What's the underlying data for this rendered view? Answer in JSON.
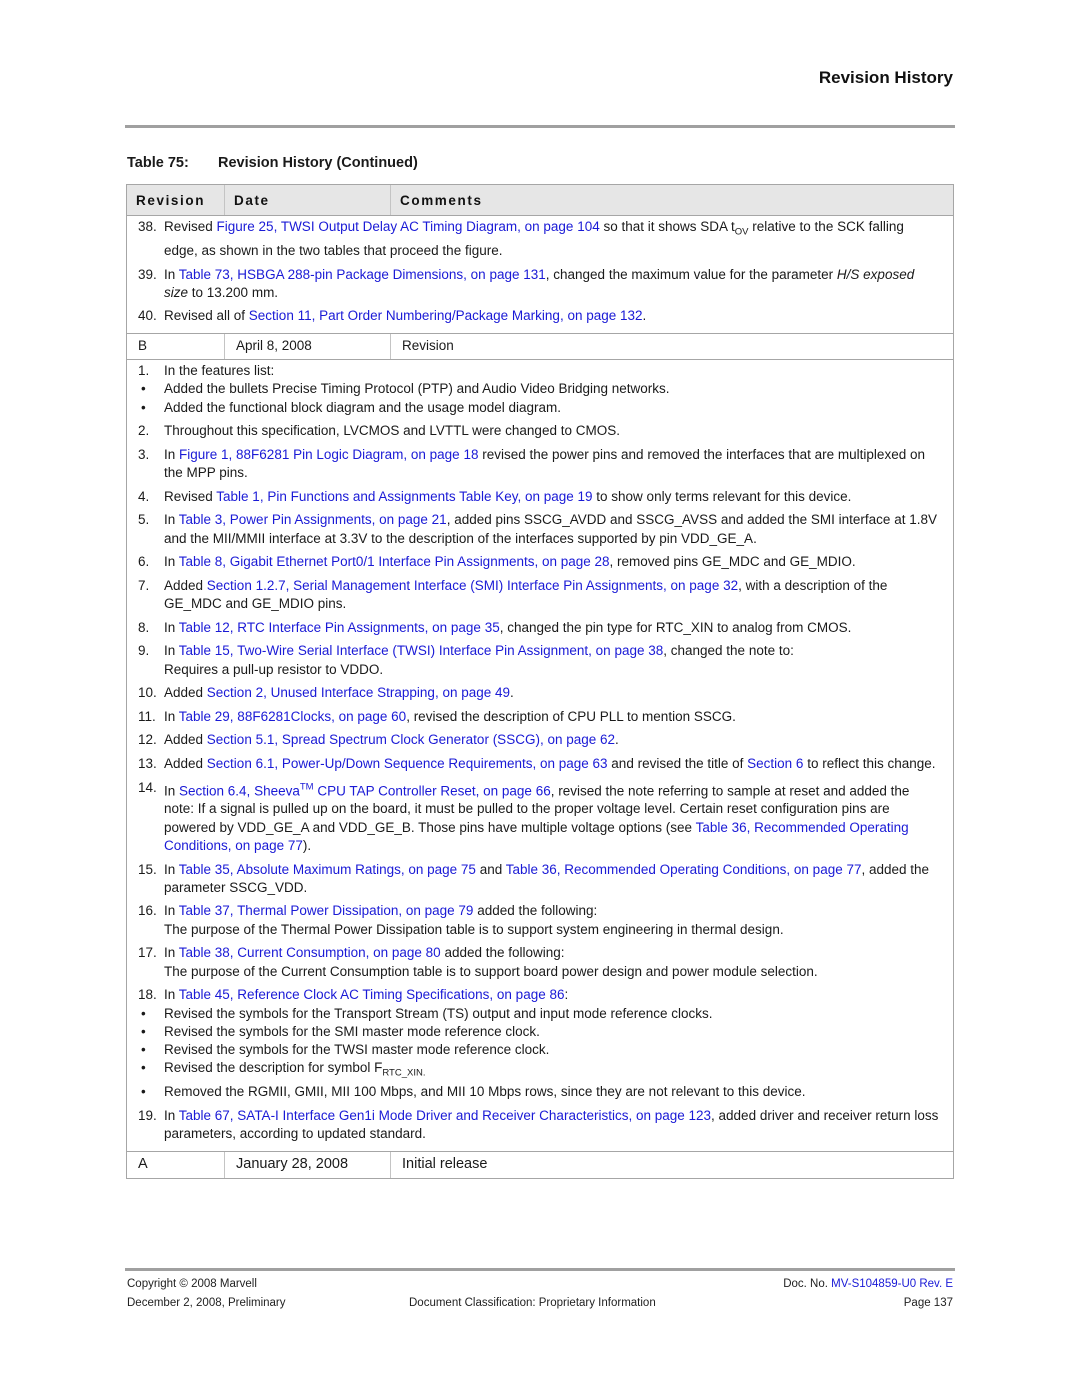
{
  "header": {
    "section_title": "Revision History"
  },
  "table": {
    "caption_number": "Table 75:",
    "caption_title": "Revision History (Continued)",
    "columns": [
      "Revision",
      "Date",
      "Comments"
    ],
    "continued_items": [
      {
        "num": "38.",
        "parts": [
          {
            "t": "Revised "
          },
          {
            "t": "Figure 25, TWSI Output Delay AC Timing Diagram, on page 104",
            "link": true
          },
          {
            "t": " so that it shows SDA t"
          },
          {
            "t": "OV",
            "sub": true
          },
          {
            "t": " relative to the SCK falling edge, as shown in the two tables that proceed the figure."
          }
        ]
      },
      {
        "num": "39.",
        "parts": [
          {
            "t": "In "
          },
          {
            "t": "Table 73, HSBGA 288-pin Package Dimensions, on page 131",
            "link": true
          },
          {
            "t": ", changed the maximum value for the parameter "
          },
          {
            "t": "H/S exposed size",
            "italic": true
          },
          {
            "t": " to 13.200 mm."
          }
        ]
      },
      {
        "num": "40.",
        "parts": [
          {
            "t": "Revised all of "
          },
          {
            "t": "Section 11, Part Order Numbering/Package Marking, on page 132",
            "link": true
          },
          {
            "t": "."
          }
        ]
      }
    ],
    "rev_b": {
      "revision": "B",
      "date": "April 8, 2008",
      "comment": "Revision"
    },
    "rev_b_items": [
      {
        "num": "1.",
        "tight": true,
        "parts": [
          {
            "t": "In the features list:"
          }
        ],
        "bullets": [
          [
            {
              "t": "Added the bullets Precise Timing Protocol (PTP) and Audio Video Bridging networks."
            }
          ],
          [
            {
              "t": "Added the functional block diagram and the usage model diagram."
            }
          ]
        ]
      },
      {
        "num": "2.",
        "parts": [
          {
            "t": "Throughout this specification, LVCMOS and LVTTL were changed to CMOS."
          }
        ]
      },
      {
        "num": "3.",
        "parts": [
          {
            "t": "In "
          },
          {
            "t": "Figure 1, 88F6281 Pin Logic Diagram, on page 18",
            "link": true
          },
          {
            "t": " revised the power pins and removed the interfaces that are multiplexed on the MPP pins."
          }
        ]
      },
      {
        "num": "4.",
        "parts": [
          {
            "t": "Revised "
          },
          {
            "t": "Table 1, Pin Functions and Assignments Table Key, on page 19",
            "link": true
          },
          {
            "t": " to show only terms relevant for this device."
          }
        ]
      },
      {
        "num": "5.",
        "parts": [
          {
            "t": "In "
          },
          {
            "t": "Table 3, Power Pin Assignments, on page 21",
            "link": true
          },
          {
            "t": ", added pins SSCG_AVDD and SSCG_AVSS and added the SMI interface at 1.8V and the MII/MMII interface at 3.3V to the description of the interfaces supported by pin VDD_GE_A."
          }
        ]
      },
      {
        "num": "6.",
        "parts": [
          {
            "t": "In "
          },
          {
            "t": "Table 8, Gigabit Ethernet Port0/1 Interface Pin Assignments, on page 28",
            "link": true
          },
          {
            "t": ", removed pins GE_MDC and GE_MDIO."
          }
        ]
      },
      {
        "num": "7.",
        "parts": [
          {
            "t": "Added "
          },
          {
            "t": "Section 1.2.7, Serial Management Interface (SMI) Interface Pin Assignments, on page 32",
            "link": true
          },
          {
            "t": ", with a description of the GE_MDC and GE_MDIO pins."
          }
        ]
      },
      {
        "num": "8.",
        "parts": [
          {
            "t": "In "
          },
          {
            "t": "Table 12, RTC Interface Pin Assignments, on page 35",
            "link": true
          },
          {
            "t": ", changed the pin type for RTC_XIN to analog from CMOS."
          }
        ]
      },
      {
        "num": "9.",
        "parts": [
          {
            "t": "In "
          },
          {
            "t": "Table 15, Two-Wire Serial Interface (TWSI) Interface Pin Assignment, on page 38",
            "link": true
          },
          {
            "t": ", changed the note to:"
          },
          {
            "br": true
          },
          {
            "t": "Requires a pull-up resistor to VDDO."
          }
        ]
      },
      {
        "num": "10.",
        "parts": [
          {
            "t": "Added "
          },
          {
            "t": "Section 2, Unused Interface Strapping, on page 49",
            "link": true
          },
          {
            "t": "."
          }
        ]
      },
      {
        "num": "11.",
        "parts": [
          {
            "t": "In "
          },
          {
            "t": "Table 29, 88F6281Clocks, on page 60",
            "link": true
          },
          {
            "t": ", revised the description of CPU PLL to mention SSCG."
          }
        ]
      },
      {
        "num": "12.",
        "parts": [
          {
            "t": "Added "
          },
          {
            "t": "Section 5.1, Spread Spectrum Clock Generator (SSCG), on page 62",
            "link": true
          },
          {
            "t": "."
          }
        ]
      },
      {
        "num": "13.",
        "parts": [
          {
            "t": "Added "
          },
          {
            "t": "Section 6.1, Power-Up/Down Sequence Requirements, on page 63",
            "link": true
          },
          {
            "t": " and revised the title of "
          },
          {
            "t": "Section 6",
            "link": true
          },
          {
            "t": " to reflect this change."
          }
        ]
      },
      {
        "num": "14.",
        "parts": [
          {
            "t": "In "
          },
          {
            "t": "Section 6.4, Sheeva",
            "link": true
          },
          {
            "t": "TM",
            "sup": true,
            "link": true
          },
          {
            "t": " CPU TAP Controller Reset, on page 66",
            "link": true
          },
          {
            "t": ", revised the note referring to sample at reset and added the note: If a signal is pulled up on the board, it must be pulled to the proper voltage level. Certain reset configuration pins are powered by VDD_GE_A and VDD_GE_B. Those pins have multiple voltage options (see "
          },
          {
            "t": "Table 36, Recommended Operating Conditions, on page 77",
            "link": true
          },
          {
            "t": ")."
          }
        ]
      },
      {
        "num": "15.",
        "parts": [
          {
            "t": "In "
          },
          {
            "t": "Table 35, Absolute Maximum Ratings, on page 75",
            "link": true
          },
          {
            "t": " and "
          },
          {
            "t": "Table 36, Recommended Operating Conditions, on page 77",
            "link": true
          },
          {
            "t": ", added the parameter SSCG_VDD."
          }
        ]
      },
      {
        "num": "16.",
        "parts": [
          {
            "t": "In "
          },
          {
            "t": "Table 37, Thermal Power Dissipation, on page 79",
            "link": true
          },
          {
            "t": " added the following:"
          },
          {
            "br": true
          },
          {
            "t": "The purpose of the Thermal Power Dissipation table is to support system engineering in thermal design."
          }
        ]
      },
      {
        "num": "17.",
        "parts": [
          {
            "t": "In "
          },
          {
            "t": "Table 38, Current Consumption, on page 80",
            "link": true
          },
          {
            "t": " added the following:"
          },
          {
            "br": true
          },
          {
            "t": "The purpose of the Current Consumption table is to support board power design and power module selection."
          }
        ]
      },
      {
        "num": "18.",
        "tight": true,
        "parts": [
          {
            "t": "In "
          },
          {
            "t": "Table 45, Reference Clock AC Timing Specifications, on page 86",
            "link": true
          },
          {
            "t": ":"
          }
        ],
        "bullets": [
          [
            {
              "t": "Revised the symbols for the Transport Stream (TS) output and input mode reference clocks."
            }
          ],
          [
            {
              "t": "Revised the symbols for the SMI master mode reference clock."
            }
          ],
          [
            {
              "t": "Revised the symbols for the TWSI master mode reference clock."
            }
          ],
          [
            {
              "t": "Revised the description for symbol F"
            },
            {
              "t": "RTC_XIN.",
              "sub": true
            }
          ],
          [
            {
              "t": "Removed the RGMII, GMII, MII 100 Mbps, and MII 10 Mbps rows, since they are not relevant to this device."
            }
          ]
        ]
      },
      {
        "num": "19.",
        "parts": [
          {
            "t": "In "
          },
          {
            "t": "Table 67, SATA-I Interface Gen1i Mode Driver and Receiver Characteristics, on page 123",
            "link": true
          },
          {
            "t": ", added driver and receiver return loss parameters, according to updated standard."
          }
        ]
      }
    ],
    "rev_a": {
      "revision": "A",
      "date": "January 28, 2008",
      "comment": "Initial release"
    }
  },
  "footer": {
    "copyright": "Copyright © 2008 Marvell",
    "date_status": "December 2, 2008, Preliminary",
    "classification": "Document Classification: Proprietary Information",
    "doc_no_prefix": "Doc. No. ",
    "doc_no": "MV-S104859-U0 Rev. E",
    "page": "Page 137"
  },
  "colors": {
    "link": "#1a1ad6",
    "header_bg": "#e6e6e6",
    "rule": "#a0a0a0"
  }
}
